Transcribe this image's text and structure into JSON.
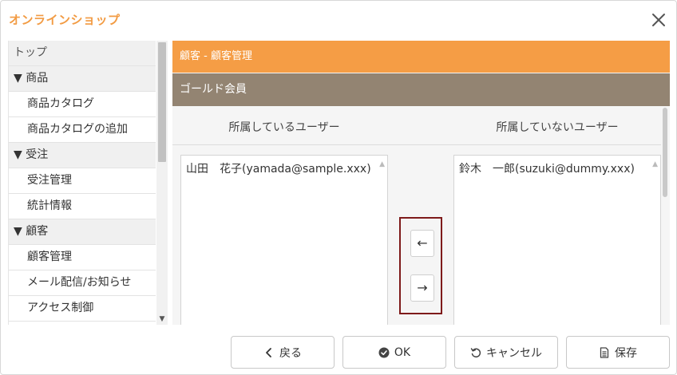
{
  "app": {
    "title": "オンラインショップ"
  },
  "sidebar": {
    "rows": [
      {
        "label": "トップ",
        "kind": "top"
      },
      {
        "label": "▼ 商品",
        "kind": "cat"
      },
      {
        "label": "商品カタログ",
        "kind": "item"
      },
      {
        "label": "商品カタログの追加",
        "kind": "item"
      },
      {
        "label": "▼ 受注",
        "kind": "cat"
      },
      {
        "label": "受注管理",
        "kind": "item"
      },
      {
        "label": "統計情報",
        "kind": "item"
      },
      {
        "label": "▼ 顧客",
        "kind": "cat"
      },
      {
        "label": "顧客管理",
        "kind": "item"
      },
      {
        "label": "メール配信/お知らせ",
        "kind": "item"
      },
      {
        "label": "アクセス制御",
        "kind": "item"
      }
    ]
  },
  "main": {
    "breadcrumb": "顧客 - 顧客管理",
    "group_name": "ゴールド会員",
    "member_heading": "所属しているユーザー",
    "nonmember_heading": "所属していないユーザー",
    "members": [
      "山田　花子(yamada@sample.xxx)"
    ],
    "nonmembers": [
      "鈴木　一郎(suzuki@dummy.xxx)"
    ],
    "move_left_label": "←",
    "move_right_label": "→"
  },
  "footer": {
    "back_label": "戻る",
    "ok_label": "OK",
    "cancel_label": "キャンセル",
    "save_label": "保存"
  },
  "colors": {
    "title": "#f29b43",
    "header_orange": "#f59d45",
    "group_brown": "#938472",
    "move_border": "#7e1a1a"
  },
  "icons": {
    "close": "close-icon",
    "back": "chevron-left-icon",
    "ok": "check-circle-icon",
    "cancel": "undo-icon",
    "save": "document-icon"
  }
}
